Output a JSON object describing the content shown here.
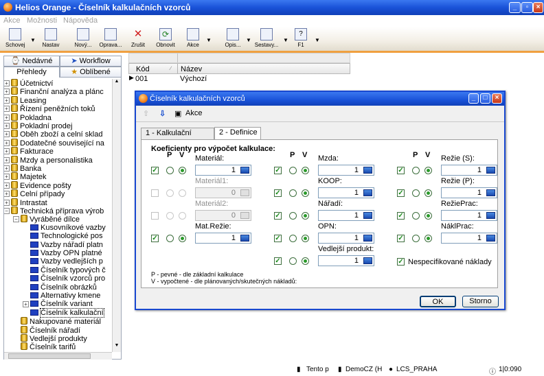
{
  "app": {
    "title": "Helios Orange - Číselník kalkulačních vzorců"
  },
  "menu": [
    "Akce",
    "Možnosti",
    "Nápověda"
  ],
  "toolbar": [
    {
      "label": "Schovej",
      "icon": "hide-icon"
    },
    {
      "label": "Nastav",
      "icon": "search-icon"
    },
    {
      "label": "Nový...",
      "icon": "new-icon"
    },
    {
      "label": "Oprava...",
      "icon": "edit-icon"
    },
    {
      "label": "Zrušit",
      "icon": "delete-icon"
    },
    {
      "label": "Obnovit",
      "icon": "refresh-icon"
    },
    {
      "label": "Akce",
      "icon": "action-icon"
    },
    {
      "label": "Opis...",
      "icon": "print-icon"
    },
    {
      "label": "Sestavy...",
      "icon": "reports-icon"
    },
    {
      "label": "F1",
      "icon": "help-icon"
    }
  ],
  "leftTabs": {
    "recent": "Nedávné",
    "workflow": "Workflow",
    "overview": "Přehledy",
    "favorites": "Oblíbené"
  },
  "tree": [
    {
      "label": "Účetnictví",
      "level": 0,
      "type": "db"
    },
    {
      "label": "Finanční analýza a plánc",
      "level": 0,
      "type": "db"
    },
    {
      "label": "Leasing",
      "level": 0,
      "type": "db"
    },
    {
      "label": "Řízení peněžních toků",
      "level": 0,
      "type": "db"
    },
    {
      "label": "Pokladna",
      "level": 0,
      "type": "db"
    },
    {
      "label": "Pokladní prodej",
      "level": 0,
      "type": "db"
    },
    {
      "label": "Oběh zboží a celní sklad",
      "level": 0,
      "type": "db"
    },
    {
      "label": "Dodatečné související na",
      "level": 0,
      "type": "db"
    },
    {
      "label": "Fakturace",
      "level": 0,
      "type": "db"
    },
    {
      "label": "Mzdy a personalistika",
      "level": 0,
      "type": "db"
    },
    {
      "label": "Banka",
      "level": 0,
      "type": "db"
    },
    {
      "label": "Majetek",
      "level": 0,
      "type": "db"
    },
    {
      "label": "Evidence pošty",
      "level": 0,
      "type": "db"
    },
    {
      "label": "Celní případy",
      "level": 0,
      "type": "db"
    },
    {
      "label": "Intrastat",
      "level": 0,
      "type": "db"
    },
    {
      "label": "Technická příprava výrob",
      "level": 0,
      "type": "db",
      "expanded": true
    },
    {
      "label": "Vyráběné dílce",
      "level": 1,
      "type": "db",
      "expanded": true
    },
    {
      "label": "Kusovníkové vazby",
      "level": 2,
      "type": "folder"
    },
    {
      "label": "Technologické pos",
      "level": 2,
      "type": "folder"
    },
    {
      "label": "Vazby nářadí platn",
      "level": 2,
      "type": "folder"
    },
    {
      "label": "Vazby OPN platné",
      "level": 2,
      "type": "folder"
    },
    {
      "label": "Vazby vedlejších p",
      "level": 2,
      "type": "folder"
    },
    {
      "label": "Číselník typových č",
      "level": 2,
      "type": "folder"
    },
    {
      "label": "Číselník vzorců pro",
      "level": 2,
      "type": "folder"
    },
    {
      "label": "Číselník obrázků",
      "level": 2,
      "type": "folder"
    },
    {
      "label": "Alternativy kmene",
      "level": 2,
      "type": "folder"
    },
    {
      "label": "Číselník variant",
      "level": 2,
      "type": "folder",
      "collapsed": true
    },
    {
      "label": "Číselník kalkulační",
      "level": 2,
      "type": "folder",
      "selected": true
    },
    {
      "label": "Nakupované materiál",
      "level": 1,
      "type": "db"
    },
    {
      "label": "Číselník nářadí",
      "level": 1,
      "type": "db"
    },
    {
      "label": "Vedlejší produkty",
      "level": 1,
      "type": "db"
    },
    {
      "label": "Číselník tarifů",
      "level": 1,
      "type": "db"
    }
  ],
  "grid": {
    "columns": [
      "Kód",
      "Název"
    ],
    "rows": [
      {
        "code": "001",
        "name": "Výchozí"
      }
    ]
  },
  "status": {
    "a": "Tento p",
    "b": "DemoCZ (H",
    "c": "LCS_PRAHA",
    "d": "1|0:090"
  },
  "dialog": {
    "title": "Číselník kalkulačních vzorců",
    "action": "Akce",
    "tabs": [
      "1 - Kalkulační vzorec",
      "2 - Definice"
    ],
    "section": "Koeficienty pro výpočet kalkulace:",
    "colP": "P",
    "colV": "V",
    "fields": [
      {
        "label": "Materiál:",
        "value": "1",
        "enabled": true,
        "checked": true
      },
      {
        "label": "Materiál1:",
        "value": "0",
        "enabled": false,
        "checked": false
      },
      {
        "label": "Materiál2:",
        "value": "0",
        "enabled": false,
        "checked": false
      },
      {
        "label": "Mat.Režie:",
        "value": "1",
        "enabled": true,
        "checked": true
      },
      {
        "label": "Mzda:",
        "value": "1",
        "enabled": true,
        "checked": true
      },
      {
        "label": "KOOP:",
        "value": "1",
        "enabled": true,
        "checked": true
      },
      {
        "label": "Nářadí:",
        "value": "1",
        "enabled": true,
        "checked": true
      },
      {
        "label": "OPN:",
        "value": "1",
        "enabled": true,
        "checked": true
      },
      {
        "label": "Vedlejší produkt:",
        "value": "1",
        "enabled": true,
        "checked": true
      },
      {
        "label": "Režie (S):",
        "value": "1",
        "enabled": true,
        "checked": true
      },
      {
        "label": "Režie (P):",
        "value": "1",
        "enabled": true,
        "checked": true
      },
      {
        "label": "RežiePrac:",
        "value": "1",
        "enabled": true,
        "checked": true
      },
      {
        "label": "NáklPrac:",
        "value": "1",
        "enabled": true,
        "checked": true
      }
    ],
    "unspecified": "Nespecifikované náklady",
    "noteP": "P - pevné - dle základní kalkulace",
    "noteV": "V - vypočtené - dle plánovaných/skutečných nákladů:",
    "ok": "OK",
    "cancel": "Storno"
  }
}
